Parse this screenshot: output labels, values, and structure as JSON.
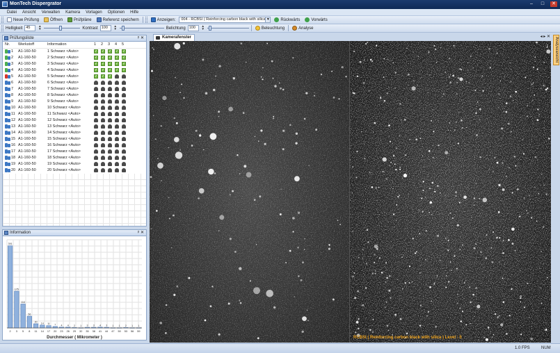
{
  "window": {
    "title": "MonTech Dispergrator",
    "controls": [
      "–",
      "□",
      "✕"
    ]
  },
  "menu": [
    "Datei",
    "Ansicht",
    "Verwalten",
    "Kamera",
    "Vorlagen",
    "Optionen",
    "Hilfe"
  ],
  "toolbar": {
    "new_test": "Neue Prüfung",
    "open": "Öffnen",
    "test_plans": "Prüfpläne",
    "save_reference": "Referenz speichern",
    "display_label": "Anzeigen:",
    "display_value": "004 - RCBSI ( Reinforcing carbon black with silica )",
    "back": "Rückwärts",
    "forward": "Vorwärts"
  },
  "toolbar2": {
    "brightness_label": "Helligkeit",
    "brightness_value": "45",
    "contrast_label": "Kontrast",
    "contrast_value": "100",
    "exposure_label": "Belichtung",
    "exposure_value": "100",
    "lighting": "Beleuchtung",
    "analysis": "Analyse"
  },
  "test_list": {
    "title": "Prüfungsliste",
    "columns": [
      "Nr.",
      "Werkstoff",
      "Information",
      "1",
      "2",
      "3",
      "4",
      "5"
    ],
    "rows": [
      {
        "nr": "1",
        "material": "A1-160-50",
        "info": "1 Schwarz <Auto>",
        "status": "done",
        "checks": [
          "ok",
          "ok",
          "ok",
          "ok",
          "ok"
        ]
      },
      {
        "nr": "2",
        "material": "A1-160-50",
        "info": "2 Schwarz <Auto>",
        "status": "done",
        "checks": [
          "ok",
          "ok",
          "ok",
          "ok",
          "ok"
        ]
      },
      {
        "nr": "3",
        "material": "A1-160-50",
        "info": "3 Schwarz <Auto>",
        "status": "done",
        "checks": [
          "ok",
          "ok",
          "ok",
          "ok",
          "ok"
        ]
      },
      {
        "nr": "4",
        "material": "A1-160-50",
        "info": "4 Schwarz <Auto>",
        "status": "done",
        "checks": [
          "ok",
          "ok",
          "ok",
          "ok",
          "ok"
        ]
      },
      {
        "nr": "5",
        "material": "A1-160-50",
        "info": "5 Schwarz <Auto>",
        "status": "active",
        "checks": [
          "ok",
          "ok",
          "ok",
          "pend",
          "pend"
        ]
      },
      {
        "nr": "6",
        "material": "A1-160-50",
        "info": "6 Schwarz <Auto>",
        "status": "pending",
        "checks": [
          "pend",
          "pend",
          "pend",
          "pend",
          "pend"
        ]
      },
      {
        "nr": "7",
        "material": "A1-160-50",
        "info": "7 Schwarz <Auto>",
        "status": "pending",
        "checks": [
          "pend",
          "pend",
          "pend",
          "pend",
          "pend"
        ]
      },
      {
        "nr": "8",
        "material": "A1-160-50",
        "info": "8 Schwarz <Auto>",
        "status": "pending",
        "checks": [
          "pend",
          "pend",
          "pend",
          "pend",
          "pend"
        ]
      },
      {
        "nr": "9",
        "material": "A1-160-50",
        "info": "9 Schwarz <Auto>",
        "status": "pending",
        "checks": [
          "pend",
          "pend",
          "pend",
          "pend",
          "pend"
        ]
      },
      {
        "nr": "10",
        "material": "A1-160-50",
        "info": "10 Schwarz <Auto>",
        "status": "pending",
        "checks": [
          "pend",
          "pend",
          "pend",
          "pend",
          "pend"
        ]
      },
      {
        "nr": "11",
        "material": "A1-160-50",
        "info": "11 Schwarz <Auto>",
        "status": "pending",
        "checks": [
          "pend",
          "pend",
          "pend",
          "pend",
          "pend"
        ]
      },
      {
        "nr": "12",
        "material": "A1-160-50",
        "info": "12 Schwarz <Auto>",
        "status": "pending",
        "checks": [
          "pend",
          "pend",
          "pend",
          "pend",
          "pend"
        ]
      },
      {
        "nr": "13",
        "material": "A1-160-50",
        "info": "13 Schwarz <Auto>",
        "status": "pending",
        "checks": [
          "pend",
          "pend",
          "pend",
          "pend",
          "pend"
        ]
      },
      {
        "nr": "14",
        "material": "A1-160-50",
        "info": "14 Schwarz <Auto>",
        "status": "pending",
        "checks": [
          "pend",
          "pend",
          "pend",
          "pend",
          "pend"
        ]
      },
      {
        "nr": "15",
        "material": "A1-160-50",
        "info": "15 Schwarz <Auto>",
        "status": "pending",
        "checks": [
          "pend",
          "pend",
          "pend",
          "pend",
          "pend"
        ]
      },
      {
        "nr": "16",
        "material": "A1-160-50",
        "info": "16 Schwarz <Auto>",
        "status": "pending",
        "checks": [
          "pend",
          "pend",
          "pend",
          "pend",
          "pend"
        ]
      },
      {
        "nr": "17",
        "material": "A1-160-50",
        "info": "17 Schwarz <Auto>",
        "status": "pending",
        "checks": [
          "pend",
          "pend",
          "pend",
          "pend",
          "pend"
        ]
      },
      {
        "nr": "18",
        "material": "A1-160-50",
        "info": "18 Schwarz <Auto>",
        "status": "pending",
        "checks": [
          "pend",
          "pend",
          "pend",
          "pend",
          "pend"
        ]
      },
      {
        "nr": "19",
        "material": "A1-160-50",
        "info": "19 Schwarz <Auto>",
        "status": "pending",
        "checks": [
          "pend",
          "pend",
          "pend",
          "pend",
          "pend"
        ]
      },
      {
        "nr": "20",
        "material": "A1-160-50",
        "info": "20 Schwarz <Auto>",
        "status": "pending",
        "checks": [
          "pend",
          "pend",
          "pend",
          "pend",
          "pend"
        ]
      }
    ]
  },
  "info_panel": {
    "title": "Information"
  },
  "chart_data": {
    "type": "bar",
    "xlabel": "Durchmesser ( Mikrometer )",
    "categories": [
      "2",
      "3",
      "5",
      "8",
      "11",
      "14",
      "17",
      "20",
      "23",
      "26",
      "29",
      "32",
      "35",
      "38",
      "41",
      "44",
      "47",
      "50",
      "53",
      "56",
      "59"
    ],
    "values": [
      391,
      175,
      114,
      56,
      20,
      14,
      11,
      7,
      4,
      4,
      2,
      1,
      3,
      3,
      4,
      3,
      1,
      1,
      2,
      1,
      1
    ],
    "ylim": [
      0,
      400
    ],
    "grid": true
  },
  "main": {
    "tab": "Kamerafenster",
    "caption": "RCBSI ( Reinforcing carbon black with silica ) Level : 5",
    "side_tab": "Analyseansicht"
  },
  "statusbar": {
    "fps": "1.0 FPS",
    "num": "NUM"
  },
  "colors": {
    "ok_green": "#76b947",
    "caption_orange": "#f0a520",
    "title_blue": "#0f2a56"
  }
}
